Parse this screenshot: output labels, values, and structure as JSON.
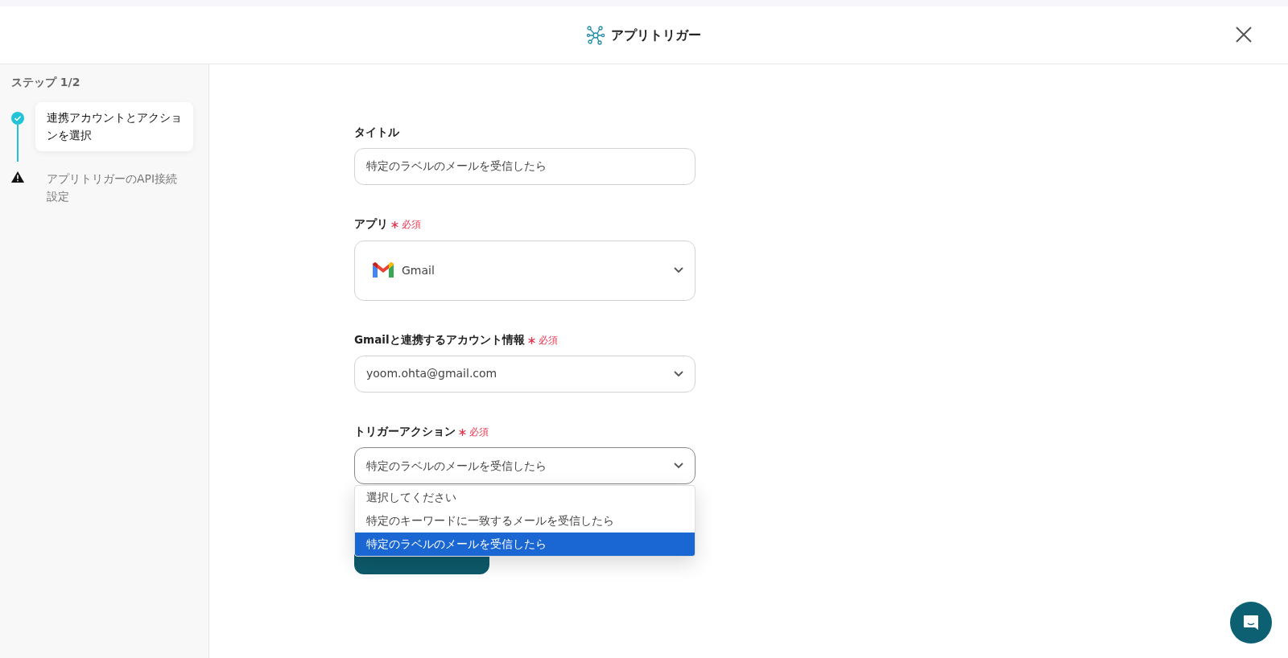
{
  "header": {
    "title": "アプリトリガー"
  },
  "sidebar": {
    "heading": "ステップ 1/2",
    "steps": [
      {
        "label": "連携アカウントとアクションを選択",
        "kind": "done",
        "selected": true
      },
      {
        "label": "アプリトリガーのAPI接続設定",
        "kind": "warning",
        "selected": false
      }
    ]
  },
  "form": {
    "fields": [
      {
        "label": "タイトル",
        "kind": "text",
        "value": "特定のラベルのメールを受信したら"
      },
      {
        "label": "アプリ",
        "required": "必須",
        "kind": "app",
        "value": "Gmail"
      },
      {
        "label": "Gmailと連携するアカウント情報",
        "required": "必須",
        "kind": "select",
        "value": "yoom.ohta@gmail.com"
      },
      {
        "label": "トリガーアクション",
        "required": "必須",
        "kind": "select",
        "value": "特定のラベルのメールを受信したら",
        "expanded": true,
        "options": [
          {
            "label": "選択してください",
            "selected": false
          },
          {
            "label": "特定のキーワードに一致するメールを受信したら",
            "selected": false
          },
          {
            "label": "特定のラベルのメールを受信したら",
            "selected": true
          }
        ]
      }
    ]
  }
}
